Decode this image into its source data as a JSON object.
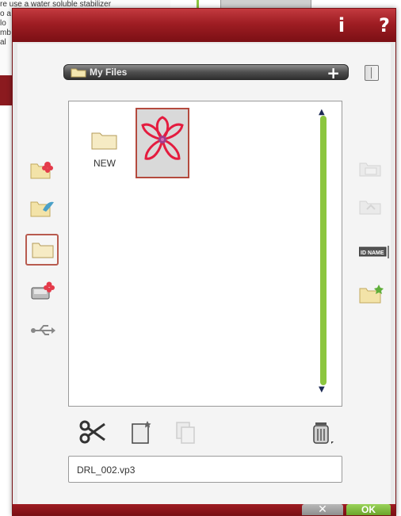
{
  "background": {
    "lines": [
      "re use a water soluble stabilizer",
      "o a",
      "lo",
      "",
      "",
      "mb",
      "al"
    ]
  },
  "titlebar": {
    "info_icon": "info-icon",
    "info_label": "i",
    "help_label": "?"
  },
  "folder_bar": {
    "title": "My Files",
    "new_folder_label": "+"
  },
  "files": [
    {
      "name": "NEW",
      "type": "folder"
    },
    {
      "name": "",
      "type": "embroidery-design",
      "selected": true
    }
  ],
  "left_nav": [
    {
      "name": "builtin-designs",
      "icon": "folder-embroidery-icon"
    },
    {
      "name": "builtin-stitches",
      "icon": "folder-stitch-icon"
    },
    {
      "name": "my-files",
      "icon": "folder-icon",
      "selected": true
    },
    {
      "name": "pc-files",
      "icon": "computer-embroidery-icon"
    },
    {
      "name": "usb-device",
      "icon": "usb-icon"
    }
  ],
  "right_nav": [
    {
      "name": "open-folder",
      "icon": "folder-open-icon",
      "enabled": false
    },
    {
      "name": "up-folder",
      "icon": "folder-up-icon",
      "enabled": false
    },
    {
      "name": "rename",
      "icon": "rename-icon",
      "enabled": true
    },
    {
      "name": "new-folder",
      "icon": "folder-new-icon",
      "enabled": true
    }
  ],
  "toolbar": {
    "cut_icon": "scissors-icon",
    "paste_icon": "paste-icon",
    "copy_icon": "copy-icon",
    "delete_icon": "trash-icon"
  },
  "rename_badge": "ID NAME",
  "filename_field": {
    "value": "DRL_002.vp3"
  },
  "bottom": {
    "cancel_label": "✕",
    "ok_label": "OK"
  },
  "colors": {
    "accent_red": "#9e1d23",
    "scroll_green": "#8cc63f",
    "ok_green": "#7ab83a"
  }
}
